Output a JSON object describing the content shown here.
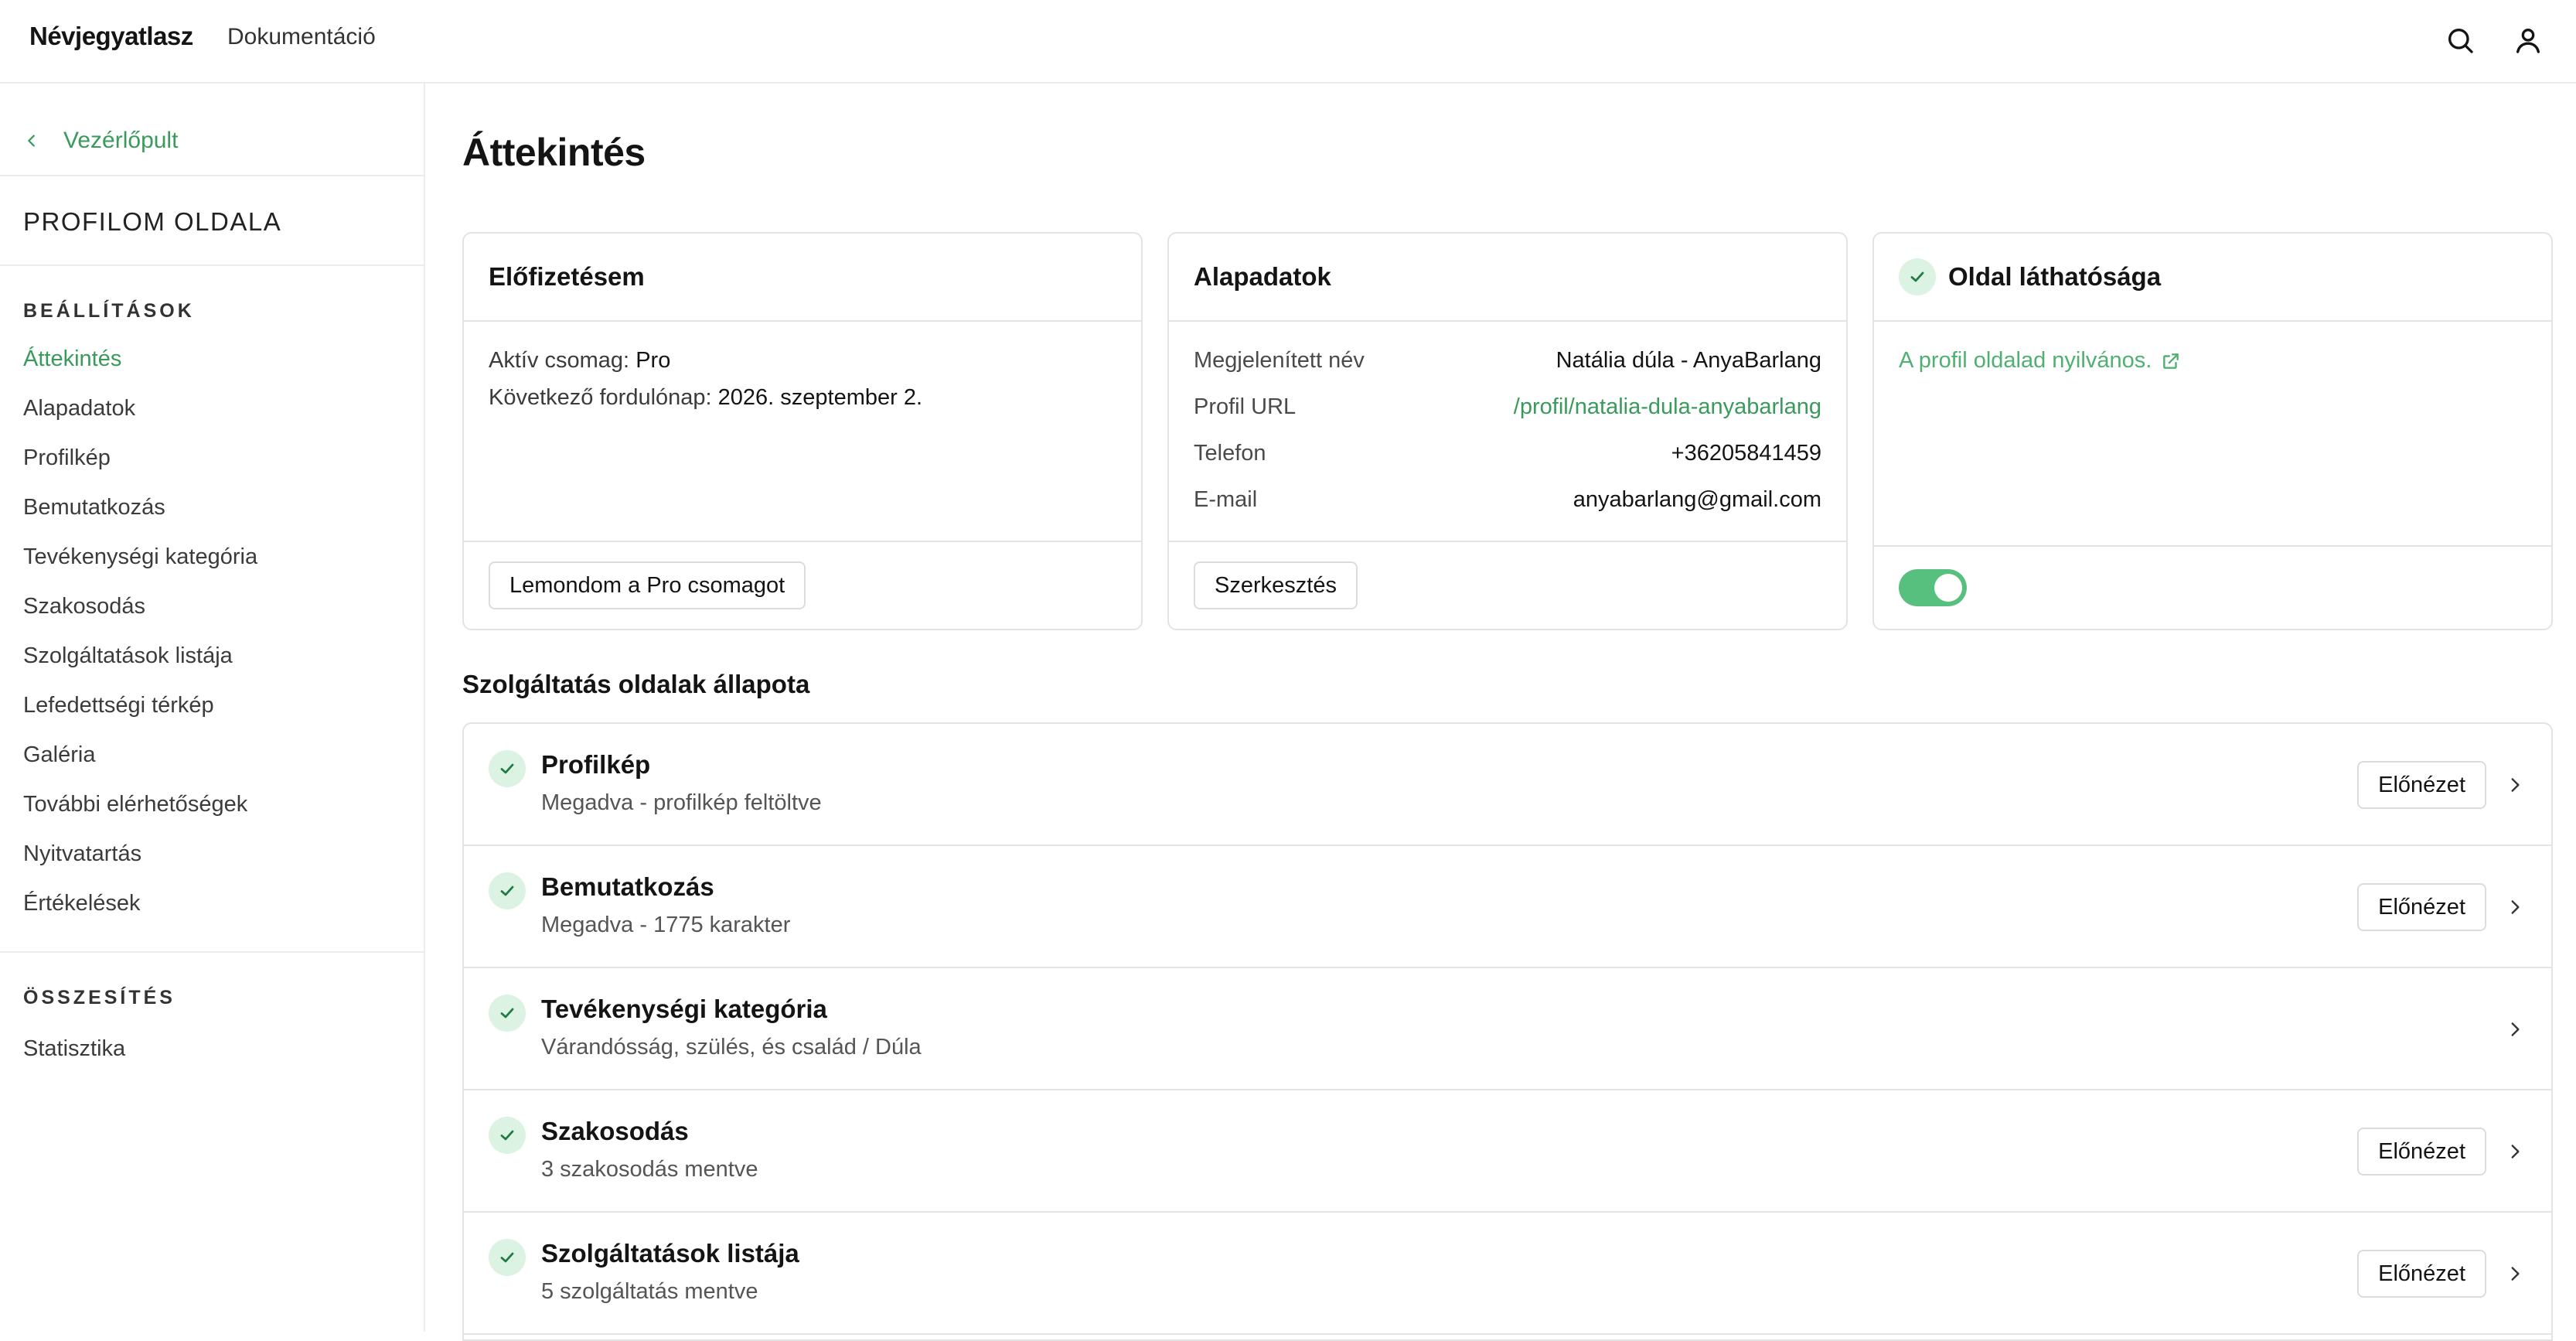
{
  "header": {
    "brand": "Névjegyatlasz",
    "docs_link": "Dokumentáció",
    "search_icon": "search-icon",
    "user_icon": "user-icon"
  },
  "sidebar": {
    "back_label": "Vezérlőpult",
    "profile_title": "PROFILOM OLDALA",
    "settings_heading": "BEÁLLÍTÁSOK",
    "items": [
      {
        "label": "Áttekintés",
        "active": true
      },
      {
        "label": "Alapadatok"
      },
      {
        "label": "Profilkép"
      },
      {
        "label": "Bemutatkozás"
      },
      {
        "label": "Tevékenységi kategória"
      },
      {
        "label": "Szakosodás"
      },
      {
        "label": "Szolgáltatások listája"
      },
      {
        "label": "Lefedettségi térkép"
      },
      {
        "label": "Galéria"
      },
      {
        "label": "További elérhetőségek"
      },
      {
        "label": "Nyitvatartás"
      },
      {
        "label": "Értékelések"
      }
    ],
    "summary_heading": "ÖSSZESÍTÉS",
    "summary_items": [
      {
        "label": "Statisztika"
      }
    ]
  },
  "main": {
    "title": "Áttekintés",
    "subscription": {
      "title": "Előfizetésem",
      "plan_label": "Aktív csomag:",
      "plan_value": "Pro",
      "renewal_label": "Következő fordulónap:",
      "renewal_value": "2026. szeptember 2.",
      "cancel_button": "Lemondom a Pro csomagot"
    },
    "basics": {
      "title": "Alapadatok",
      "rows": [
        {
          "key": "Megjelenített név",
          "value": "Natália dúla - AnyaBarlang"
        },
        {
          "key": "Profil URL",
          "value": "/profil/natalia-dula-anyabarlang"
        },
        {
          "key": "Telefon",
          "value": "+36205841459"
        },
        {
          "key": "E-mail",
          "value": "anyabarlang@gmail.com"
        }
      ],
      "edit_button": "Szerkesztés"
    },
    "visibility": {
      "title": "Oldal láthatósága",
      "public_text": "A profil oldalad nyilvános.",
      "toggle_on": true
    },
    "services": {
      "title": "Szolgáltatás oldalak állapota",
      "preview_label": "Előnézet",
      "rows": [
        {
          "name": "Profilkép",
          "desc": "Megadva - profilkép feltöltve",
          "has_preview": true
        },
        {
          "name": "Bemutatkozás",
          "desc": "Megadva - 1775 karakter",
          "has_preview": true
        },
        {
          "name": "Tevékenységi kategória",
          "desc": "Várandósság, szülés, és család / Dúla",
          "has_preview": false
        },
        {
          "name": "Szakosodás",
          "desc": "3 szakosodás mentve",
          "has_preview": true
        },
        {
          "name": "Szolgáltatások listája",
          "desc": "5 szolgáltatás mentve",
          "has_preview": true
        }
      ]
    }
  },
  "colors": {
    "accent": "#3a9a5c",
    "check_bg": "#dcf3e4",
    "toggle_on": "#58c07e",
    "border": "#e3e3e3"
  }
}
